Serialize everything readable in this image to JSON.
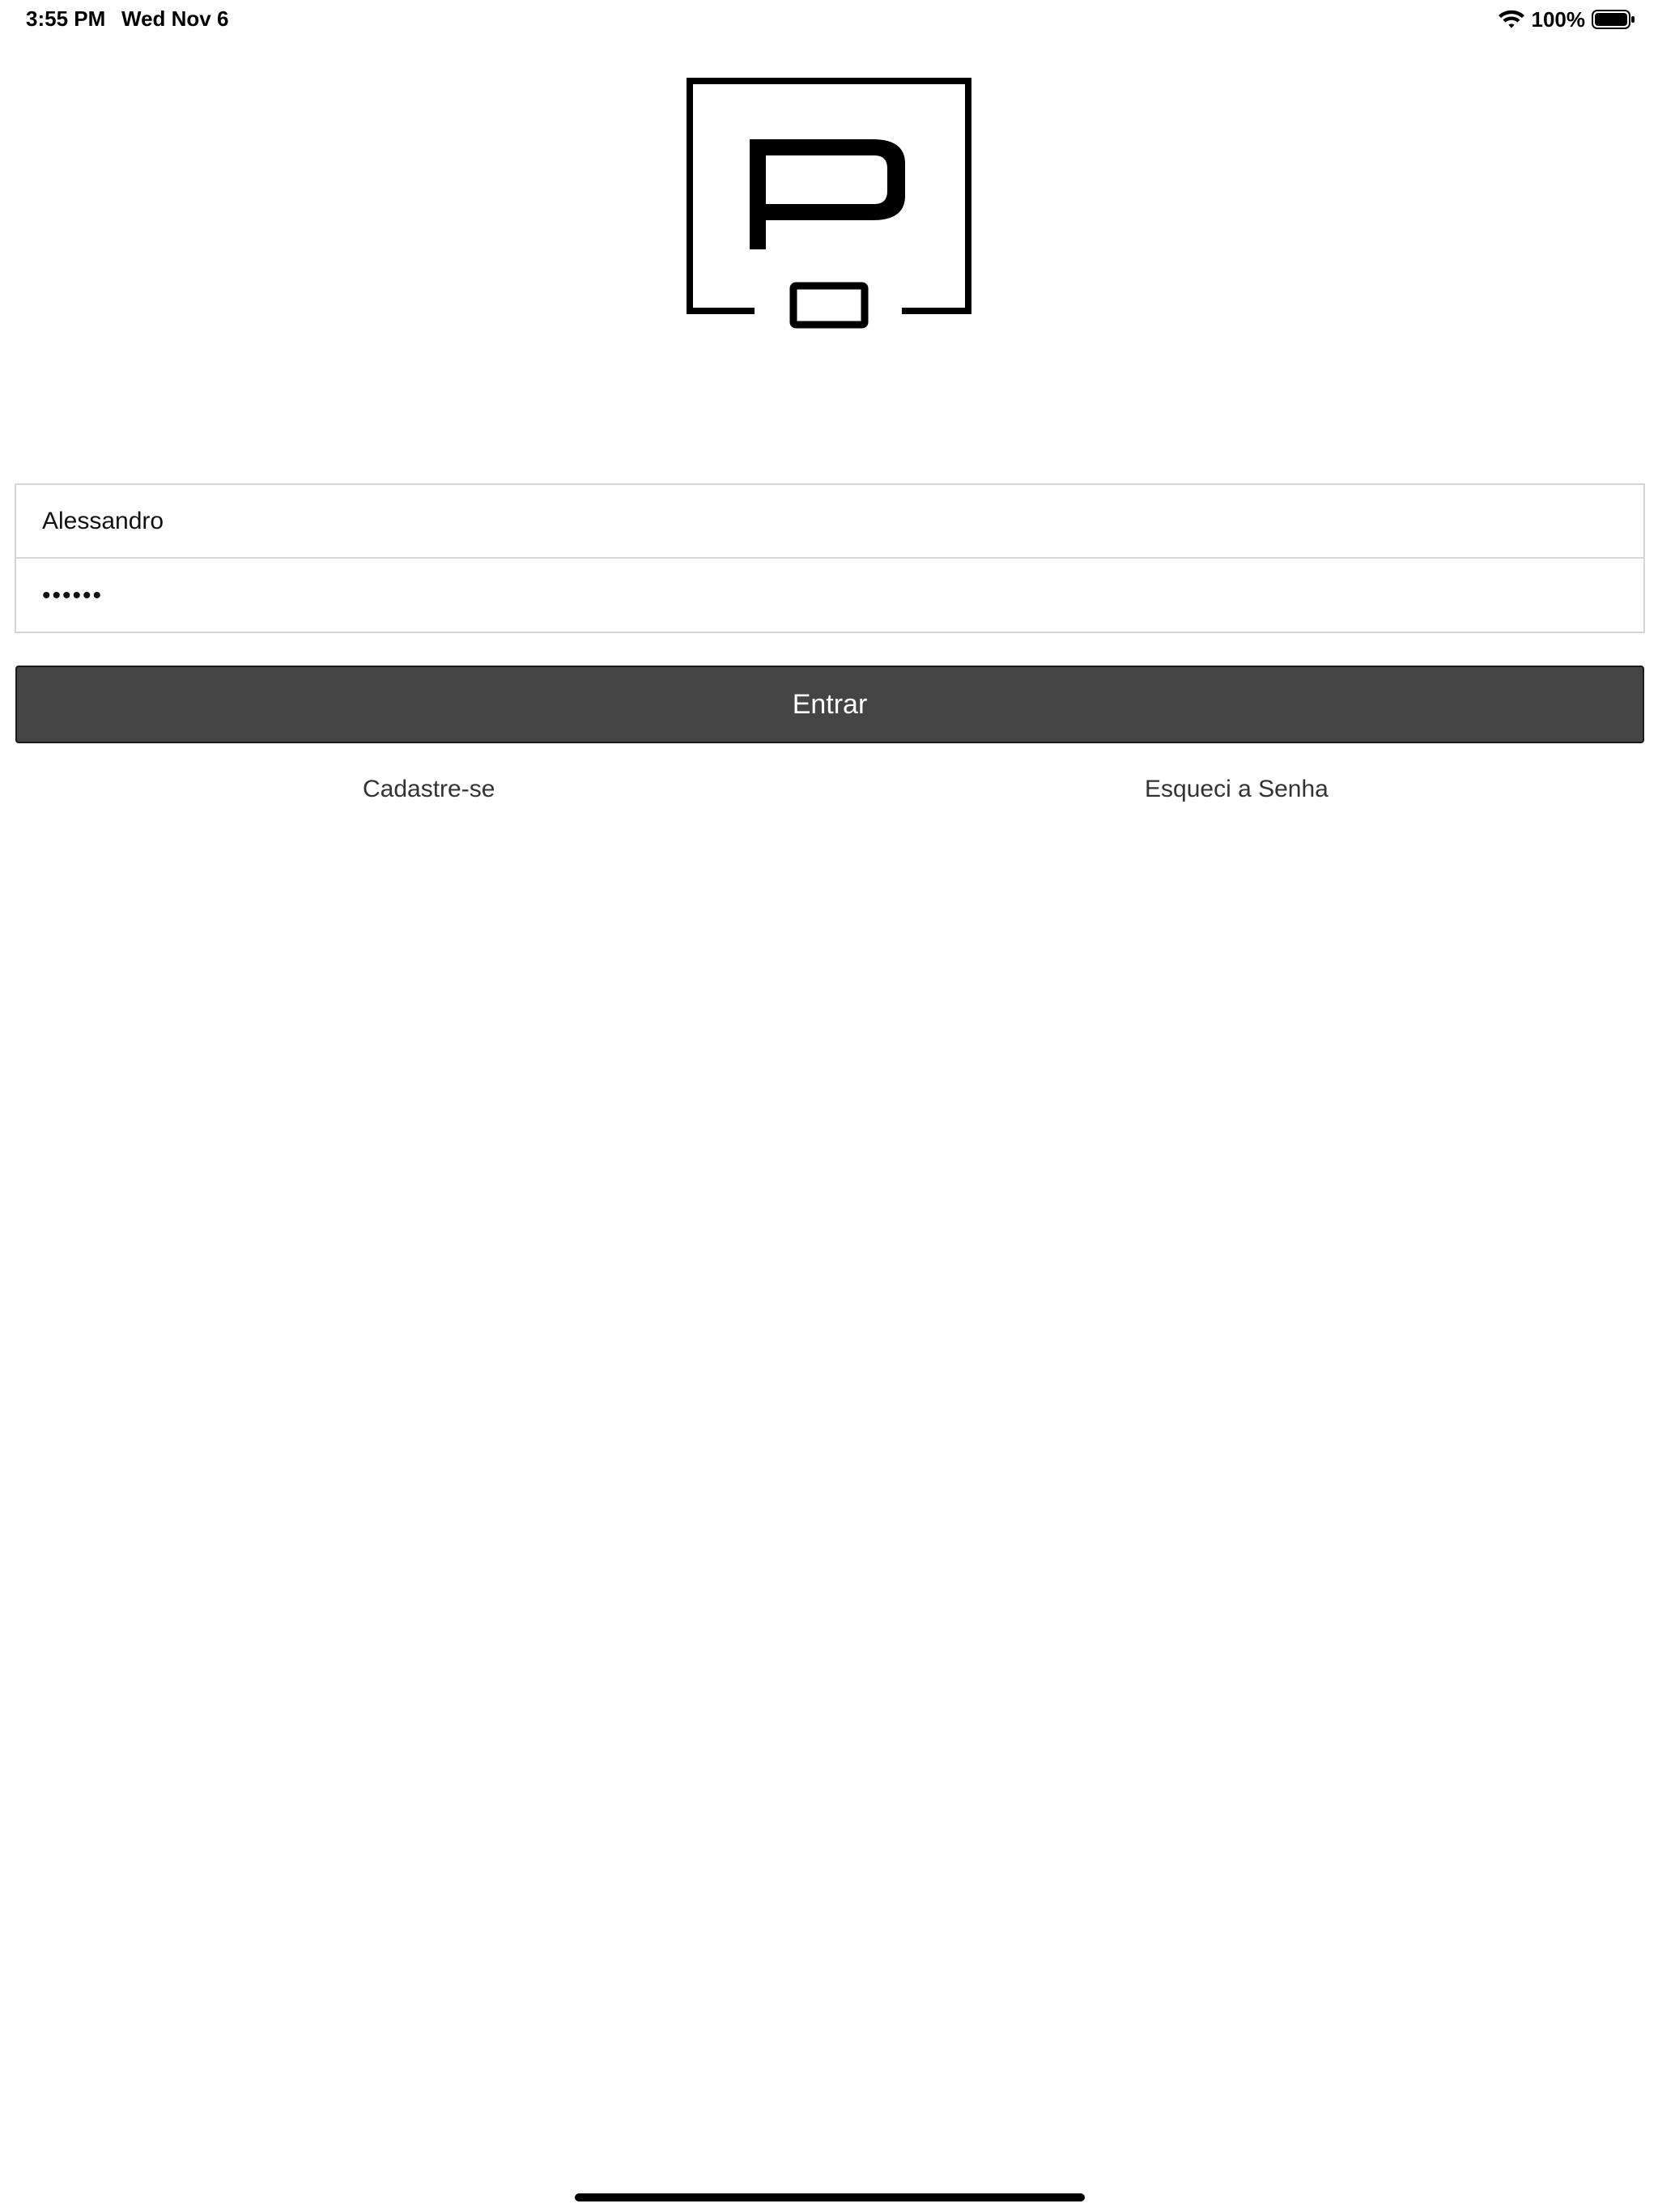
{
  "status_bar": {
    "time": "3:55 PM",
    "date": "Wed Nov 6",
    "battery_percent": "100%",
    "icons": {
      "wifi": "wifi-icon",
      "battery": "battery-icon"
    }
  },
  "logo": {
    "name": "brand-logo",
    "icon": "p-logo-icon"
  },
  "form": {
    "username_value": "Alessandro",
    "password_value": "••••••"
  },
  "actions": {
    "login_label": "Entrar",
    "register_label": "Cadastre-se",
    "forgot_label": "Esqueci a Senha"
  },
  "colors": {
    "button_background": "#454545",
    "button_text": "#ffffff",
    "field_border": "#d6d6d6",
    "link_text": "#333333"
  }
}
